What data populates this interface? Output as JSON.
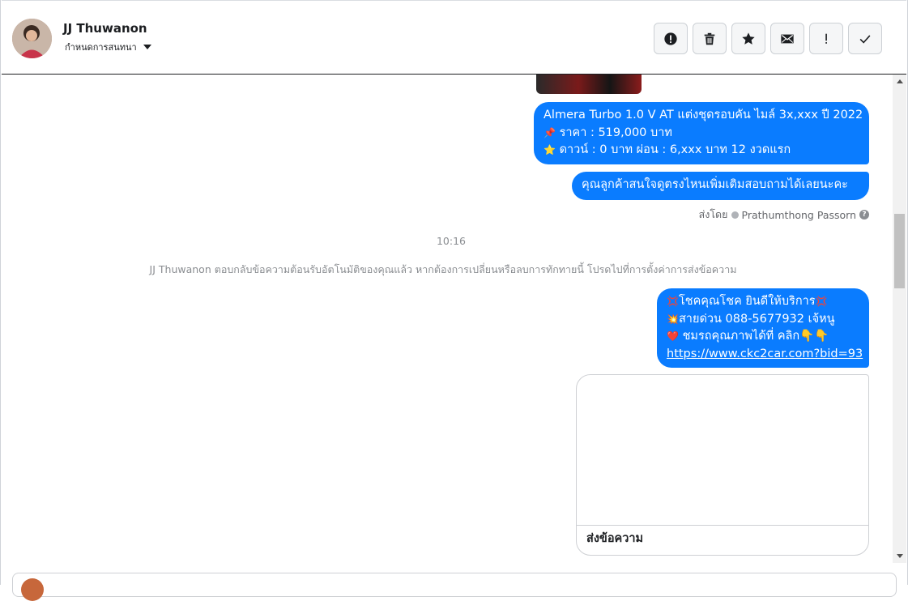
{
  "header": {
    "contact_name": "JJ Thuwanon",
    "assign_label": "กำหนดการสนทนา",
    "actions": [
      {
        "name": "report-button",
        "icon": "alert-circle-icon"
      },
      {
        "name": "delete-button",
        "icon": "trash-icon"
      },
      {
        "name": "star-button",
        "icon": "star-icon"
      },
      {
        "name": "mark-unread-button",
        "icon": "envelope-icon"
      },
      {
        "name": "flag-button",
        "icon": "exclamation-icon"
      },
      {
        "name": "done-button",
        "icon": "checkmark-icon"
      }
    ]
  },
  "messages": {
    "car_listing": {
      "line1": "Almera Turbo 1.0 V AT แต่งชุดรอบคัน ไมล์ 3x,xxx ปี 2022",
      "line2_icon": "📌",
      "line2": "ราคา : 519,000 บาท",
      "line3_icon": "⭐",
      "line3": "ดาวน์ : 0 บาท ผ่อน : 6,xxx บาท 12 งวดแรก"
    },
    "inquiry": "คุณลูกค้าสนใจดูตรงไหนเพิ่มเติมสอบถามได้เลยนะคะ",
    "sent_by_label": "ส่งโดย",
    "sent_by_name": "Prathumthong Passorn",
    "timestamp": "10:16",
    "system_notice": "JJ Thuwanon ตอบกลับข้อความต้อนรับอัตโนมัติของคุณแล้ว หากต้องการเปลี่ยนหรือลบการทักทายนี้ โปรดไปที่การตั้งค่าการส่งข้อความ",
    "promo": {
      "line1_icon": "💢",
      "line1": "โชคคุณโชค ยินดีให้บริการ",
      "line1_end_icon": "💢",
      "line2_icon": "💥",
      "line2": "สายด่วน 088-5677932 เจ้หนู",
      "line3_icon": "❤️",
      "line3": "ชมรถคุณภาพได้ที่   คลิก👇👇",
      "link": "https://www.ckc2car.com?bid=93"
    },
    "card_button_label": "ส่งข้อความ"
  },
  "colors": {
    "bubble_blue": "#0a7cff",
    "meta_gray": "#8a8d91"
  }
}
